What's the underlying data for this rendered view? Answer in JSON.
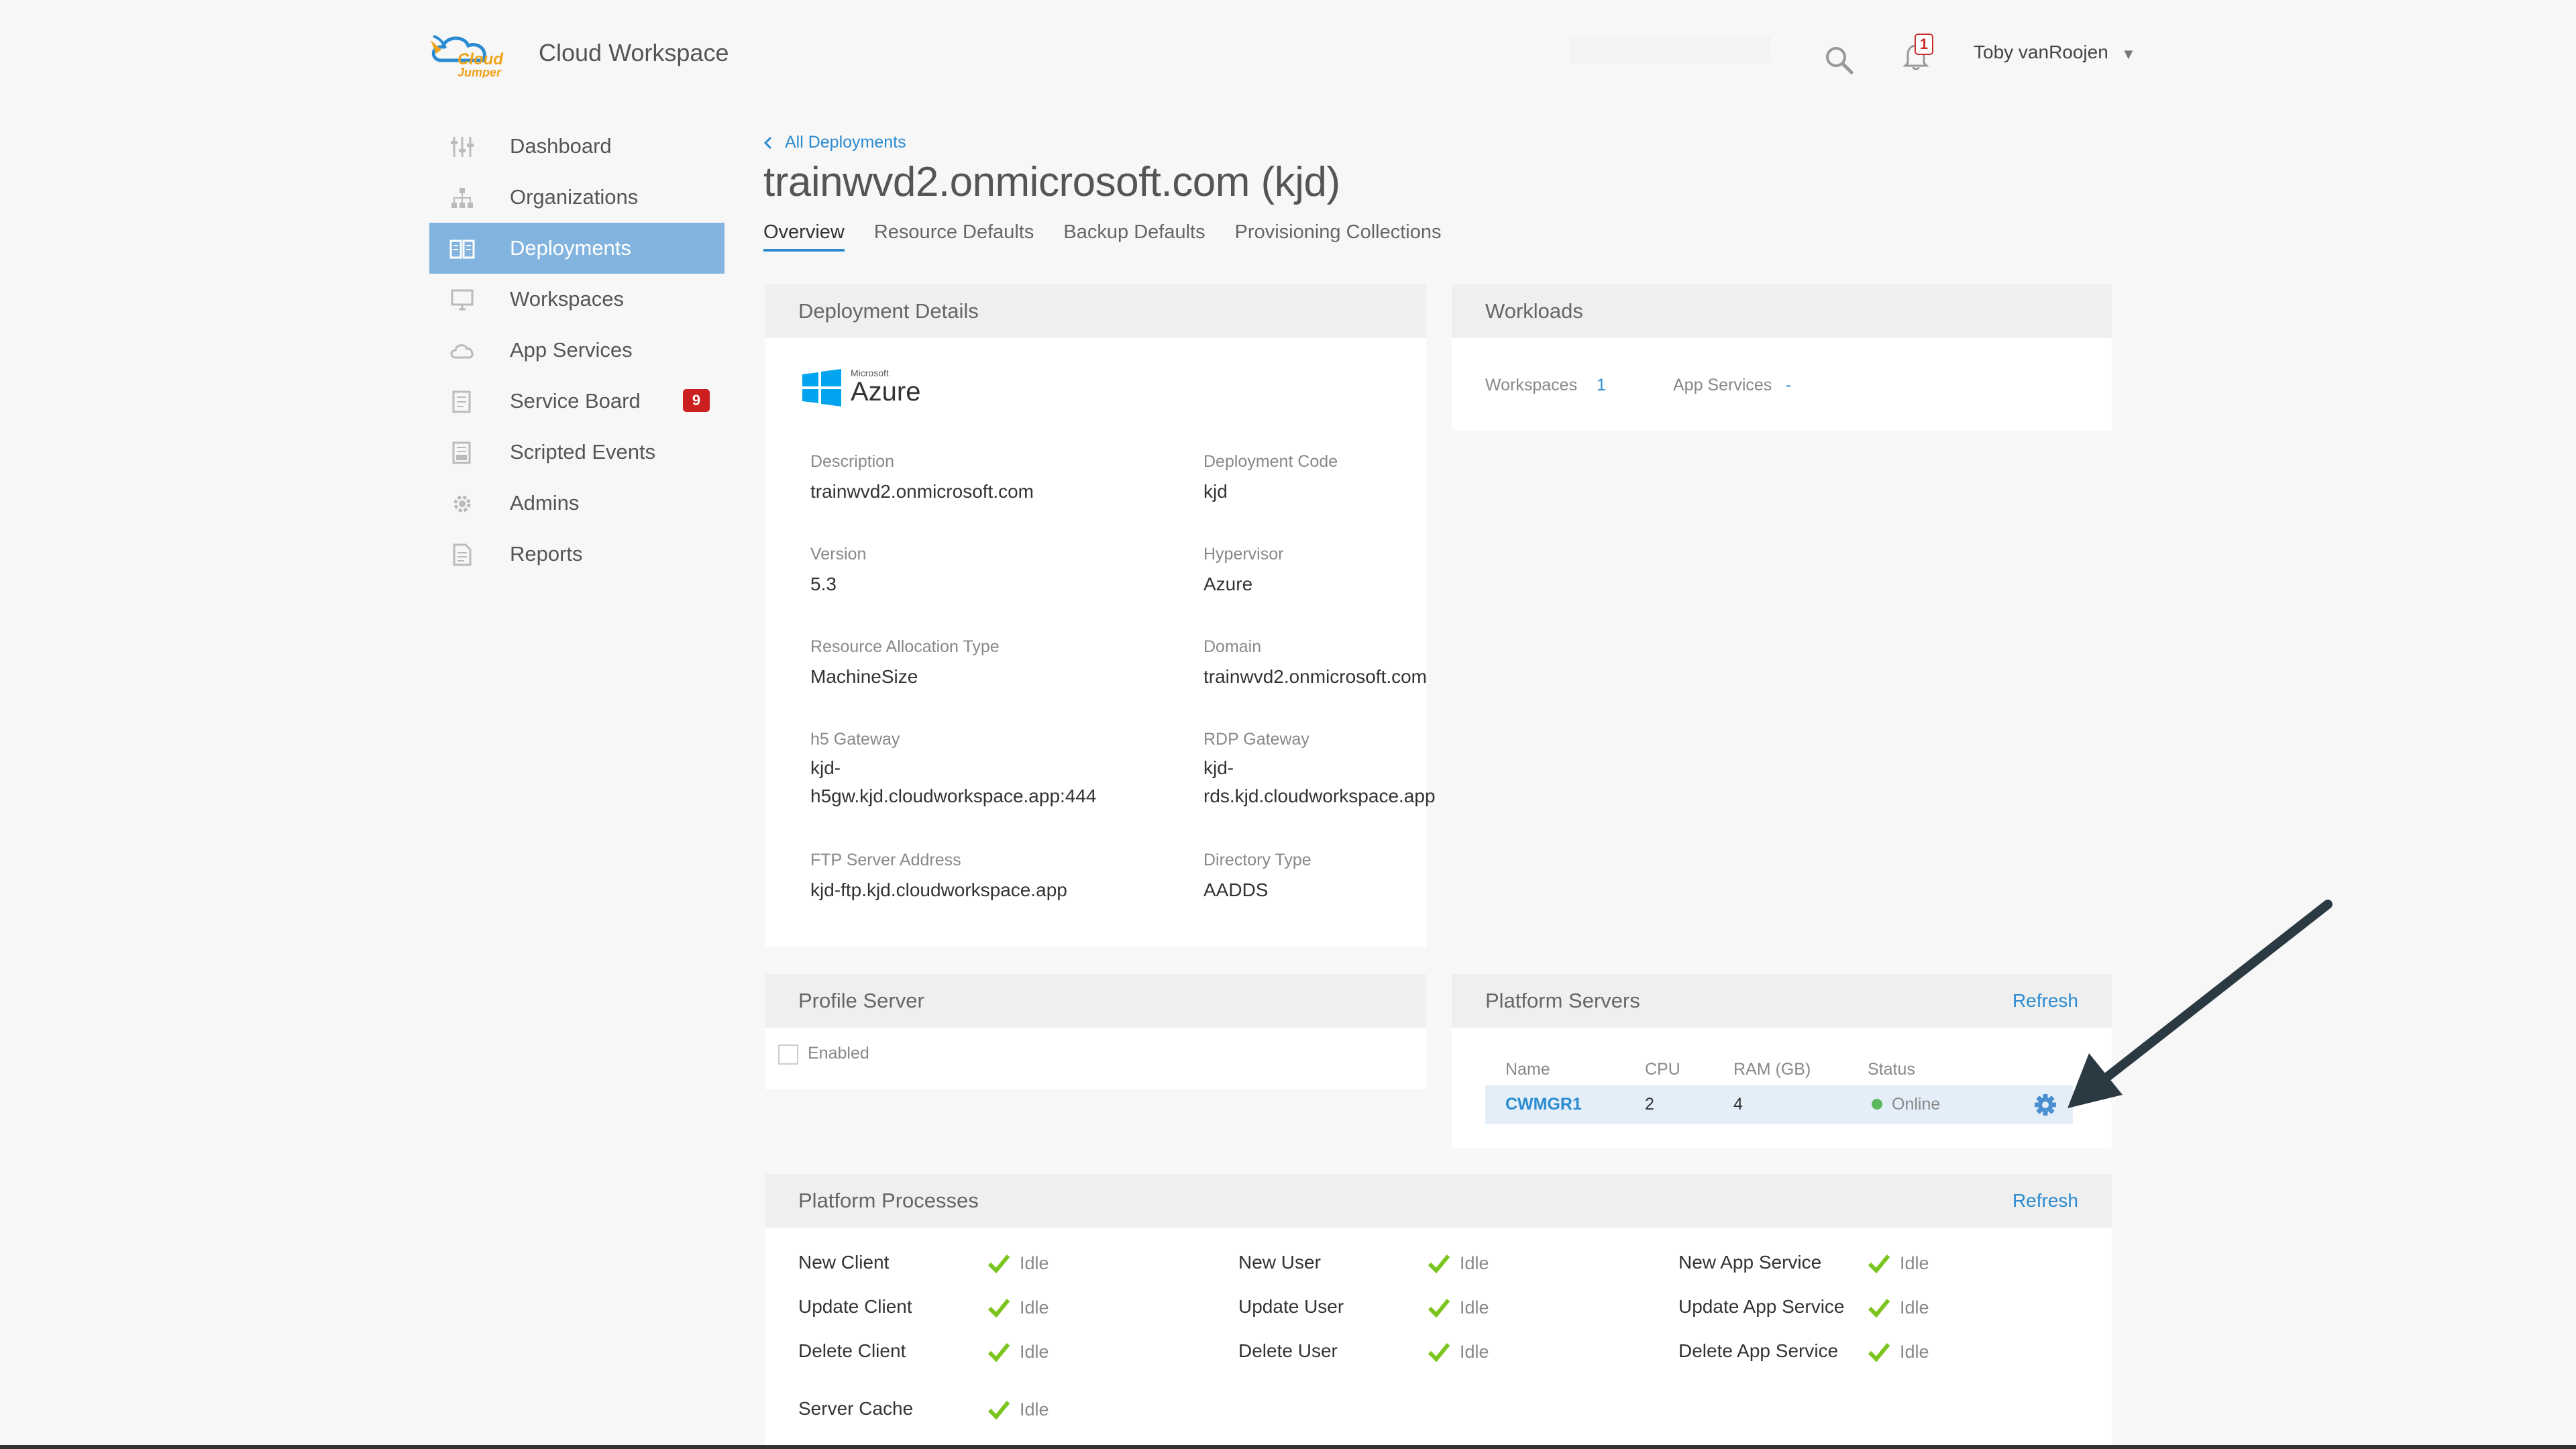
{
  "header": {
    "app_title": "Cloud Workspace",
    "logo_text": "Cloud Jumper",
    "notification_count": "1",
    "user_name": "Toby vanRoojen",
    "user_caret": "▼",
    "icons": [
      "search-icon",
      "bell-icon",
      "chevron-down-icon"
    ]
  },
  "sidebar": {
    "items": [
      {
        "label": "Dashboard",
        "icon": "sliders-icon"
      },
      {
        "label": "Organizations",
        "icon": "org-chart-icon"
      },
      {
        "label": "Deployments",
        "icon": "book-icon",
        "active": true
      },
      {
        "label": "Workspaces",
        "icon": "monitor-icon"
      },
      {
        "label": "App Services",
        "icon": "cloud-icon"
      },
      {
        "label": "Service Board",
        "icon": "list-icon",
        "badge": "9"
      },
      {
        "label": "Scripted Events",
        "icon": "script-icon"
      },
      {
        "label": "Admins",
        "icon": "gear-user-icon"
      },
      {
        "label": "Reports",
        "icon": "document-icon"
      }
    ]
  },
  "main": {
    "breadcrumb": "All Deployments",
    "title": "trainwvd2.onmicrosoft.com (kjd)",
    "tabs": [
      "Overview",
      "Resource Defaults",
      "Backup Defaults",
      "Provisioning Collections"
    ],
    "active_tab": "Overview"
  },
  "deployment_details": {
    "title": "Deployment Details",
    "provider_small": "Microsoft",
    "provider": "Azure",
    "fields": {
      "description": {
        "label": "Description",
        "value": "trainwvd2.onmicrosoft.com"
      },
      "deployment_code": {
        "label": "Deployment Code",
        "value": "kjd"
      },
      "version": {
        "label": "Version",
        "value": "5.3"
      },
      "hypervisor": {
        "label": "Hypervisor",
        "value": "Azure"
      },
      "resource_allocation": {
        "label": "Resource Allocation Type",
        "value": "MachineSize"
      },
      "domain": {
        "label": "Domain",
        "value": "trainwvd2.onmicrosoft.com"
      },
      "h5_gateway": {
        "label": "h5 Gateway",
        "value_line1": "kjd-",
        "value_line2": "h5gw.kjd.cloudworkspace.app:444"
      },
      "rdp_gateway": {
        "label": "RDP Gateway",
        "value_line1": "kjd-",
        "value_line2": "rds.kjd.cloudworkspace.app"
      },
      "ftp_server": {
        "label": "FTP Server Address",
        "value": "kjd-ftp.kjd.cloudworkspace.app"
      },
      "directory_type": {
        "label": "Directory Type",
        "value": "AADDS"
      }
    }
  },
  "workloads": {
    "title": "Workloads",
    "workspaces_label": "Workspaces",
    "workspaces_value": "1",
    "app_services_label": "App Services",
    "app_services_value": "-"
  },
  "profile_server": {
    "title": "Profile Server",
    "enabled_label": "Enabled",
    "enabled": false
  },
  "platform_servers": {
    "title": "Platform Servers",
    "refresh_label": "Refresh",
    "columns": [
      "Name",
      "CPU",
      "RAM (GB)",
      "Status"
    ],
    "rows": [
      {
        "name": "CWMGR1",
        "cpu": "2",
        "ram": "4",
        "status": "Online",
        "status_color": "#5cb85c"
      }
    ]
  },
  "platform_processes": {
    "title": "Platform Processes",
    "refresh_label": "Refresh",
    "processes": [
      {
        "name": "New Client",
        "status": "Idle"
      },
      {
        "name": "New User",
        "status": "Idle"
      },
      {
        "name": "New App Service",
        "status": "Idle"
      },
      {
        "name": "Update Client",
        "status": "Idle"
      },
      {
        "name": "Update User",
        "status": "Idle"
      },
      {
        "name": "Update App Service",
        "status": "Idle"
      },
      {
        "name": "Delete Client",
        "status": "Idle"
      },
      {
        "name": "Delete User",
        "status": "Idle"
      },
      {
        "name": "Delete App Service",
        "status": "Idle"
      },
      {
        "name": "Server Cache",
        "status": "Idle"
      }
    ]
  },
  "colors": {
    "accent": "#2a8bd0",
    "active_nav": "#83b4df",
    "badge_red": "#cc1f1f",
    "check_green": "#7cc520",
    "annotation_arrow": "#2b3a42"
  }
}
